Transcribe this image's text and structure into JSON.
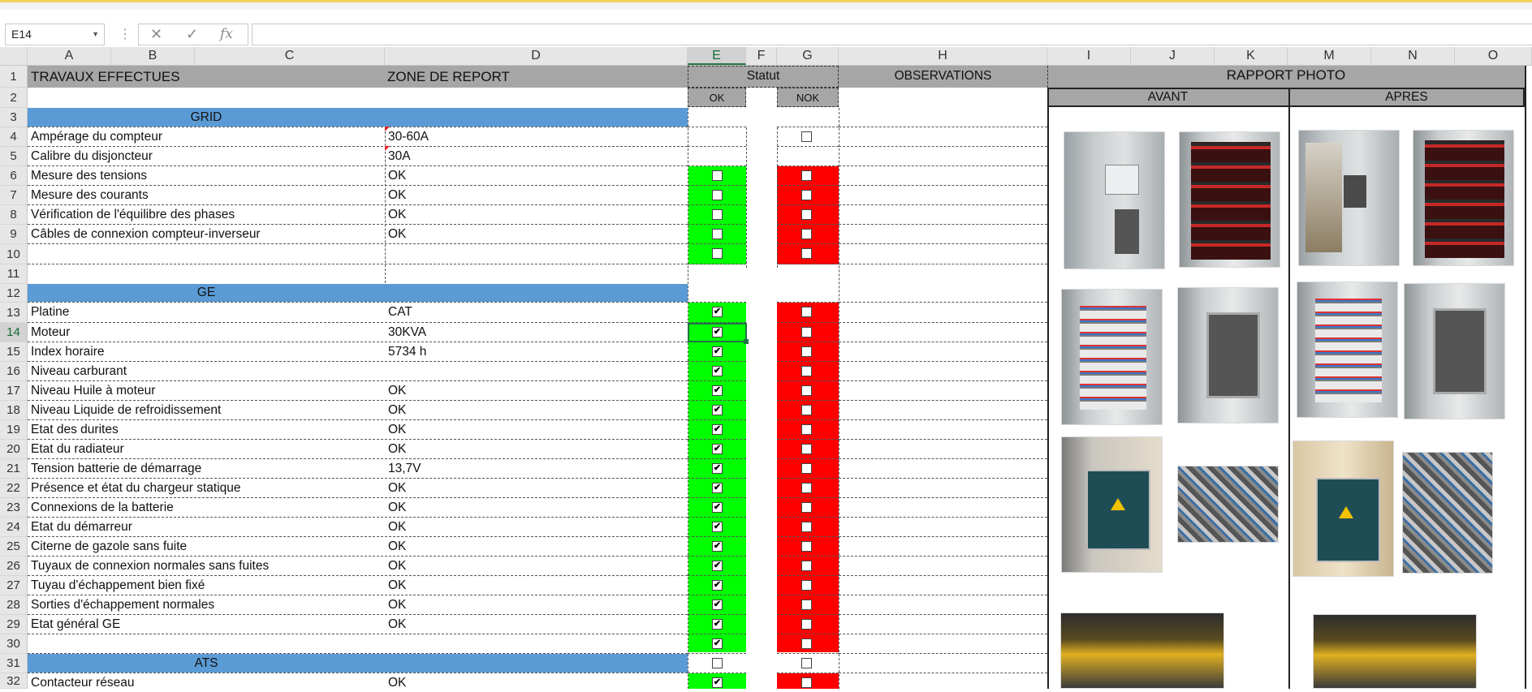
{
  "formula_bar": {
    "name_box": "E14",
    "formula_icons": [
      "✕",
      "✓",
      "fx"
    ],
    "formula": ""
  },
  "columns": [
    "A",
    "B",
    "C",
    "D",
    "E",
    "F",
    "G",
    "H",
    "I",
    "J",
    "K",
    "M",
    "N",
    "O"
  ],
  "selected_column": "E",
  "rows": [
    "1",
    "2",
    "3",
    "4",
    "5",
    "6",
    "7",
    "8",
    "9",
    "10",
    "11",
    "12",
    "13",
    "14",
    "15",
    "16",
    "17",
    "18",
    "19",
    "20",
    "21",
    "22",
    "23",
    "24",
    "25",
    "26",
    "27",
    "28",
    "29",
    "30",
    "31",
    "32"
  ],
  "selected_row": "14",
  "headers": {
    "travaux": "TRAVAUX EFFECTUES",
    "zone": "ZONE DE REPORT",
    "statut": "Statut",
    "observations": "OBSERVATIONS",
    "rapport_photo": "RAPPORT PHOTO",
    "ok": "OK",
    "nok": "NOK",
    "avant": "AVANT",
    "apres": "APRES"
  },
  "sections": {
    "grid": "GRID",
    "ge": "GE",
    "ats": "ATS"
  },
  "items": [
    {
      "row": "4",
      "label": "Ampérage du compteur",
      "value": "30-60A",
      "ok": null,
      "nok": false
    },
    {
      "row": "5",
      "label": "Calibre du disjoncteur",
      "value": "30A",
      "ok": null,
      "nok": null
    },
    {
      "row": "6",
      "label": "Mesure des tensions",
      "value": "OK",
      "ok": false,
      "nok": false
    },
    {
      "row": "7",
      "label": "Mesure des courants",
      "value": "OK",
      "ok": false,
      "nok": false
    },
    {
      "row": "8",
      "label": "Vérification de l'équilibre des phases",
      "value": "OK",
      "ok": false,
      "nok": false
    },
    {
      "row": "9",
      "label": "Câbles de connexion compteur-inverseur",
      "value": "OK",
      "ok": false,
      "nok": false
    },
    {
      "row": "10",
      "label": "",
      "value": "",
      "ok": false,
      "nok": false
    },
    {
      "row": "13",
      "label": "Platine",
      "value": "CAT",
      "ok": true,
      "nok": false
    },
    {
      "row": "14",
      "label": "Moteur",
      "value": "30KVA",
      "ok": true,
      "nok": false
    },
    {
      "row": "15",
      "label": "Index horaire",
      "value": "5734 h",
      "ok": true,
      "nok": false
    },
    {
      "row": "16",
      "label": "Niveau carburant",
      "value": "",
      "ok": true,
      "nok": false
    },
    {
      "row": "17",
      "label": "Niveau Huile à moteur",
      "value": "OK",
      "ok": true,
      "nok": false
    },
    {
      "row": "18",
      "label": "Niveau Liquide de refroidissement",
      "value": "OK",
      "ok": true,
      "nok": false
    },
    {
      "row": "19",
      "label": "Etat des durites",
      "value": "OK",
      "ok": true,
      "nok": false
    },
    {
      "row": "20",
      "label": "Etat du radiateur",
      "value": "OK",
      "ok": true,
      "nok": false
    },
    {
      "row": "21",
      "label": "Tension batterie de démarrage",
      "value": "13,7V",
      "ok": true,
      "nok": false
    },
    {
      "row": "22",
      "label": "Présence et état du chargeur statique",
      "value": "OK",
      "ok": true,
      "nok": false
    },
    {
      "row": "23",
      "label": "Connexions de la batterie",
      "value": "OK",
      "ok": true,
      "nok": false
    },
    {
      "row": "24",
      "label": "Etat du démarreur",
      "value": "OK",
      "ok": true,
      "nok": false
    },
    {
      "row": "25",
      "label": "Citerne de gazole sans fuite",
      "value": "OK",
      "ok": true,
      "nok": false
    },
    {
      "row": "26",
      "label": "Tuyaux de connexion normales sans fuites",
      "value": "OK",
      "ok": true,
      "nok": false
    },
    {
      "row": "27",
      "label": "Tuyau d'échappement bien fixé",
      "value": "OK",
      "ok": true,
      "nok": false
    },
    {
      "row": "28",
      "label": "Sorties d'échappement normales",
      "value": "OK",
      "ok": true,
      "nok": false
    },
    {
      "row": "29",
      "label": "Etat général GE",
      "value": "OK",
      "ok": true,
      "nok": false
    },
    {
      "row": "30",
      "label": "",
      "value": "",
      "ok": true,
      "nok": false
    },
    {
      "row": "31",
      "label": "",
      "value": "",
      "ok": false,
      "nok": false
    },
    {
      "row": "32",
      "label": "Contacteur réseau",
      "value": "OK",
      "ok": true,
      "nok": false
    }
  ],
  "colors": {
    "header_gray": "#a6a6a6",
    "section_blue": "#5b9bd5",
    "ok_green": "#00ff00",
    "nok_red": "#ff0000",
    "selection_green": "#217346"
  }
}
